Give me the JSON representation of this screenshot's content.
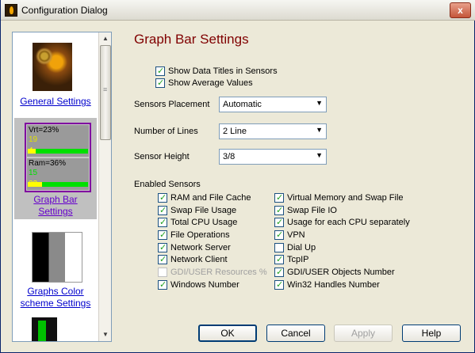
{
  "window": {
    "title": "Configuration Dialog",
    "close_label": "x"
  },
  "sidebar": {
    "items": [
      {
        "label": "General Settings",
        "icon": "general-settings-icon"
      },
      {
        "label": "Graph Bar Settings",
        "icon": "graph-bar-icon",
        "selected": true,
        "preview": {
          "vrt": "Vrt=23%",
          "vrt_a": "19",
          "vrt_b": "4",
          "ram": "Ram=36%",
          "ram_a": "15",
          "ram_b": "22"
        }
      },
      {
        "label": "Graphs Color scheme Settings",
        "icon": "color-scheme-icon"
      },
      {
        "label": "",
        "icon": "partial-settings-icon"
      }
    ]
  },
  "page": {
    "title": "Graph Bar Settings",
    "top_options": [
      {
        "label": "Show Data Titles in Sensors",
        "checked": true
      },
      {
        "label": "Show Average Values",
        "checked": true
      }
    ],
    "fields": [
      {
        "label": "Sensors Placement",
        "value": "Automatic"
      },
      {
        "label": "Number of Lines",
        "value": "2 Line"
      },
      {
        "label": "Sensor Height",
        "value": "3/8"
      }
    ],
    "sensors_label": "Enabled Sensors",
    "sensors_left": [
      {
        "label": "RAM and  File Cache",
        "checked": true
      },
      {
        "label": "Swap File Usage",
        "checked": true
      },
      {
        "label": "Total CPU Usage",
        "checked": true
      },
      {
        "label": "File Operations",
        "checked": true
      },
      {
        "label": "Network Server",
        "checked": true
      },
      {
        "label": "Network Client",
        "checked": true
      },
      {
        "label": "GDI/USER Resources %",
        "checked": false,
        "disabled": true
      },
      {
        "label": "Windows Number",
        "checked": true
      }
    ],
    "sensors_right": [
      {
        "label": "Virtual Memory and Swap File",
        "checked": true
      },
      {
        "label": "Swap File IO",
        "checked": true
      },
      {
        "label": "Usage for each CPU separately",
        "checked": true
      },
      {
        "label": "VPN",
        "checked": true
      },
      {
        "label": "Dial Up",
        "checked": false
      },
      {
        "label": "TcpIP",
        "checked": true
      },
      {
        "label": "GDI/USER Objects Number",
        "checked": true
      },
      {
        "label": "Win32 Handles Number",
        "checked": true
      }
    ]
  },
  "buttons": {
    "ok": "OK",
    "cancel": "Cancel",
    "apply": "Apply",
    "help": "Help"
  }
}
